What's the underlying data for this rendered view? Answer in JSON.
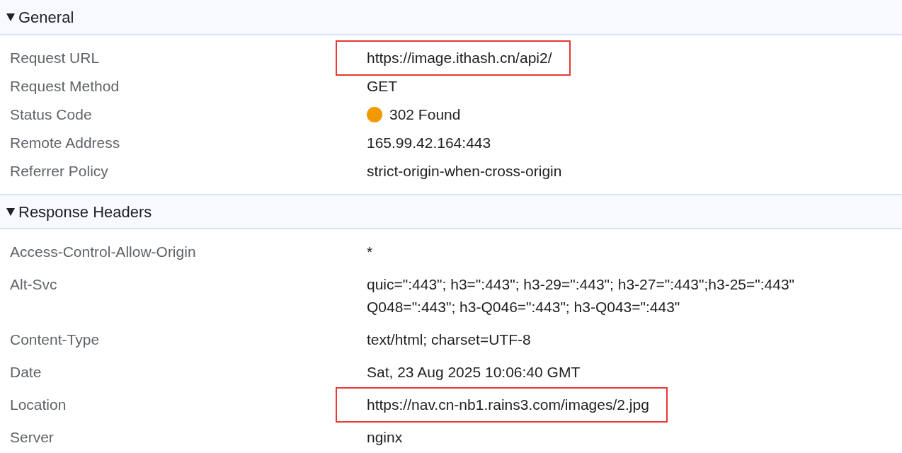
{
  "sections": [
    {
      "title": "General",
      "expanded": true,
      "kind": "compact",
      "rows": [
        {
          "name": "Request URL",
          "value": [
            "https://image.ithash.cn/api2/"
          ],
          "highlighted": true
        },
        {
          "name": "Request Method",
          "value": [
            "GET"
          ],
          "highlighted": false
        },
        {
          "name": "Status Code",
          "value": [
            "302 Found"
          ],
          "highlighted": false,
          "color": "#f29900"
        },
        {
          "name": "Remote Address",
          "value": [
            "165.99.42.164:443"
          ],
          "highlighted": false
        },
        {
          "name": "Referrer Policy",
          "value": [
            "strict-origin-when-cross-origin"
          ],
          "highlighted": false
        }
      ]
    },
    {
      "title": "Response Headers",
      "expanded": true,
      "kind": "spaced",
      "rows": [
        {
          "name": "Access-Control-Allow-Origin",
          "value": [
            "*"
          ],
          "highlighted": false
        },
        {
          "name": "Alt-Svc",
          "value": [
            "quic=\":443\"; h3=\":443\"; h3-29=\":443\"; h3-27=\":443\";h3-25=\":443\"",
            "Q048=\":443\"; h3-Q046=\":443\"; h3-Q043=\":443\""
          ],
          "highlighted": false
        },
        {
          "name": "Content-Type",
          "value": [
            "text/html; charset=UTF-8"
          ],
          "highlighted": false
        },
        {
          "name": "Date",
          "value": [
            "Sat, 23 Aug 2025 10:06:40 GMT"
          ],
          "highlighted": false
        },
        {
          "name": "Location",
          "value": [
            "https://nav.cn-nb1.rains3.com/images/2.jpg"
          ],
          "highlighted": true
        },
        {
          "name": "Server",
          "value": [
            "nginx"
          ],
          "highlighted": false
        }
      ]
    }
  ]
}
